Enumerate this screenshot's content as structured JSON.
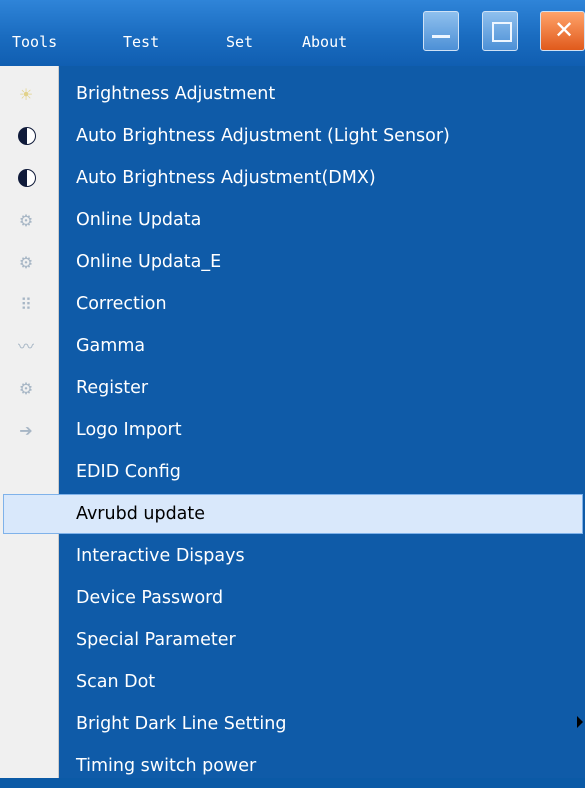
{
  "menubar": {
    "items": [
      "Tools",
      "Test",
      "Set",
      "About"
    ],
    "window_buttons": {
      "minimize": "minimize-icon",
      "maximize": "maximize-icon",
      "close": "close-icon"
    },
    "close_glyph": "✕"
  },
  "dropdown": {
    "items": [
      {
        "label": "Brightness Adjustment",
        "icon": "sun-icon",
        "glyph": "☀"
      },
      {
        "label": "Auto Brightness Adjustment (Light Sensor)",
        "icon": "half-moon-icon"
      },
      {
        "label": "Auto Brightness Adjustment(DMX)",
        "icon": "half-moon-icon"
      },
      {
        "label": "Online Updata",
        "icon": "gear-icon",
        "glyph": "⚙"
      },
      {
        "label": "Online Updata_E",
        "icon": "gear-icon",
        "glyph": "⚙"
      },
      {
        "label": "Correction",
        "icon": "grid-icon",
        "glyph": "⠿"
      },
      {
        "label": "Gamma",
        "icon": "curve-icon",
        "glyph": "〰"
      },
      {
        "label": "Register",
        "icon": "gear-icon",
        "glyph": "⚙"
      },
      {
        "label": "Logo Import",
        "icon": "import-icon",
        "glyph": "➔"
      },
      {
        "label": "EDID Config",
        "icon": ""
      },
      {
        "label": "Avrubd update",
        "icon": "",
        "highlighted": true
      },
      {
        "label": "Interactive Dispays",
        "icon": ""
      },
      {
        "label": "Device Password",
        "icon": ""
      },
      {
        "label": "Special Parameter",
        "icon": ""
      },
      {
        "label": "Scan Dot",
        "icon": ""
      },
      {
        "label": "Bright Dark Line Setting",
        "icon": "",
        "has_submenu": true
      },
      {
        "label": "Timing switch power",
        "icon": ""
      }
    ]
  },
  "colors": {
    "menu_bg": "#0f5ba8",
    "highlight_bg": "#d9e8fb",
    "gutter_bg": "#f0f0f0"
  }
}
